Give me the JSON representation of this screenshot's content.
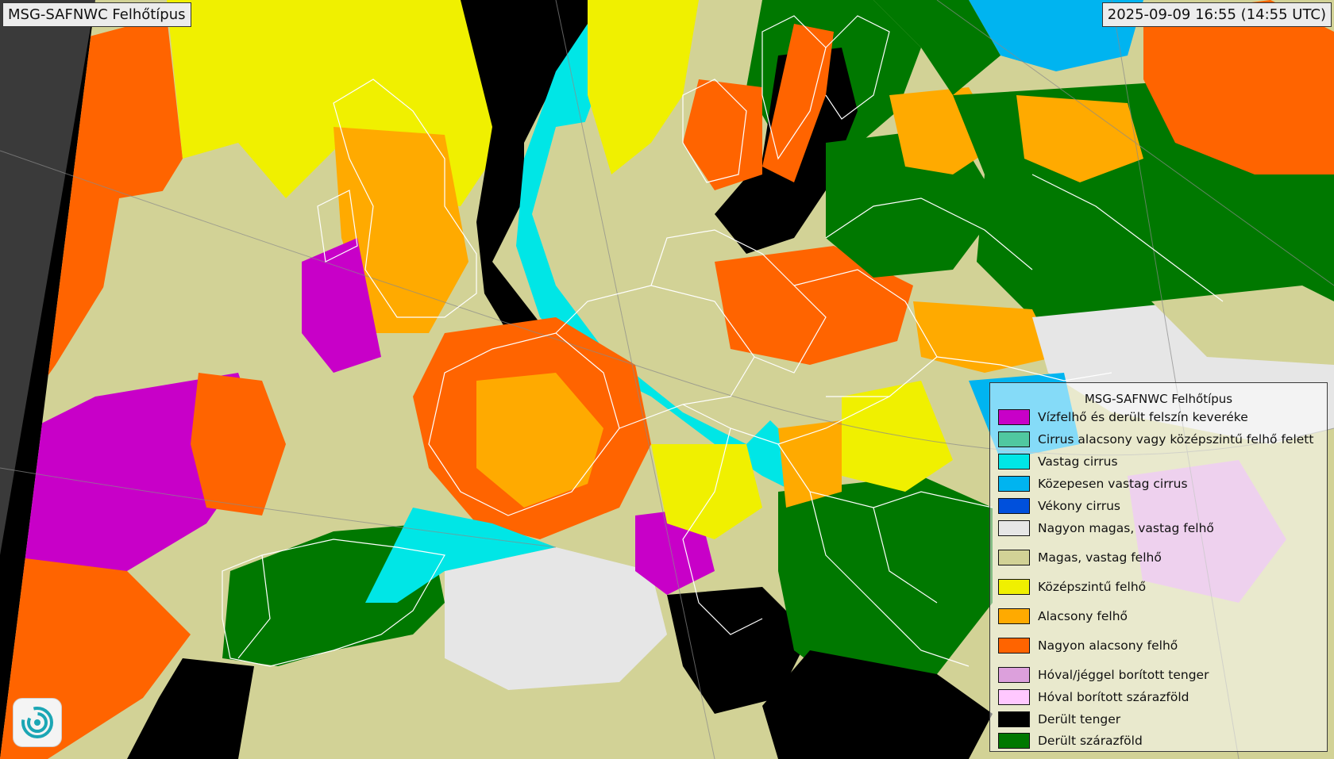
{
  "header": {
    "title": "MSG-SAFNWC Felhőtípus",
    "datetime": "2025-09-09 16:55 (14:55 UTC)"
  },
  "legend": {
    "title": "MSG-SAFNWC Felhőtípus",
    "items": [
      {
        "label": "Vízfelhő és derült felszín keveréke",
        "color": "#c800c8"
      },
      {
        "label": "Cirrus alacsony vagy középszintű felhő felett",
        "color": "#50c8a0"
      },
      {
        "label": "Vastag cirrus",
        "color": "#00e6e6"
      },
      {
        "label": "Közepesen vastag cirrus",
        "color": "#00b4f0"
      },
      {
        "label": "Vékony cirrus",
        "color": "#0050dc"
      },
      {
        "label": "Nagyon magas, vastag felhő",
        "color": "#e6e6e6"
      },
      {
        "label": "Magas, vastag felhő",
        "color": "#d2d296"
      },
      {
        "label": "Középszintű felhő",
        "color": "#f0f000"
      },
      {
        "label": "Alacsony felhő",
        "color": "#ffaa00"
      },
      {
        "label": "Nagyon alacsony felhő",
        "color": "#ff6400"
      },
      {
        "label": "Hóval/jéggel borított tenger",
        "color": "#dca0dc"
      },
      {
        "label": "Hóval borított szárazföld",
        "color": "#ffc8ff"
      },
      {
        "label": "Derült tenger",
        "color": "#000000"
      },
      {
        "label": "Derült szárazföld",
        "color": "#007800"
      }
    ]
  },
  "colors": {
    "outside_domain": "#3a3a3a",
    "no_data": "#b4b4b4",
    "borders": "#ffffff"
  },
  "logo": {
    "icon": "satellite-swirl-logo-icon"
  }
}
